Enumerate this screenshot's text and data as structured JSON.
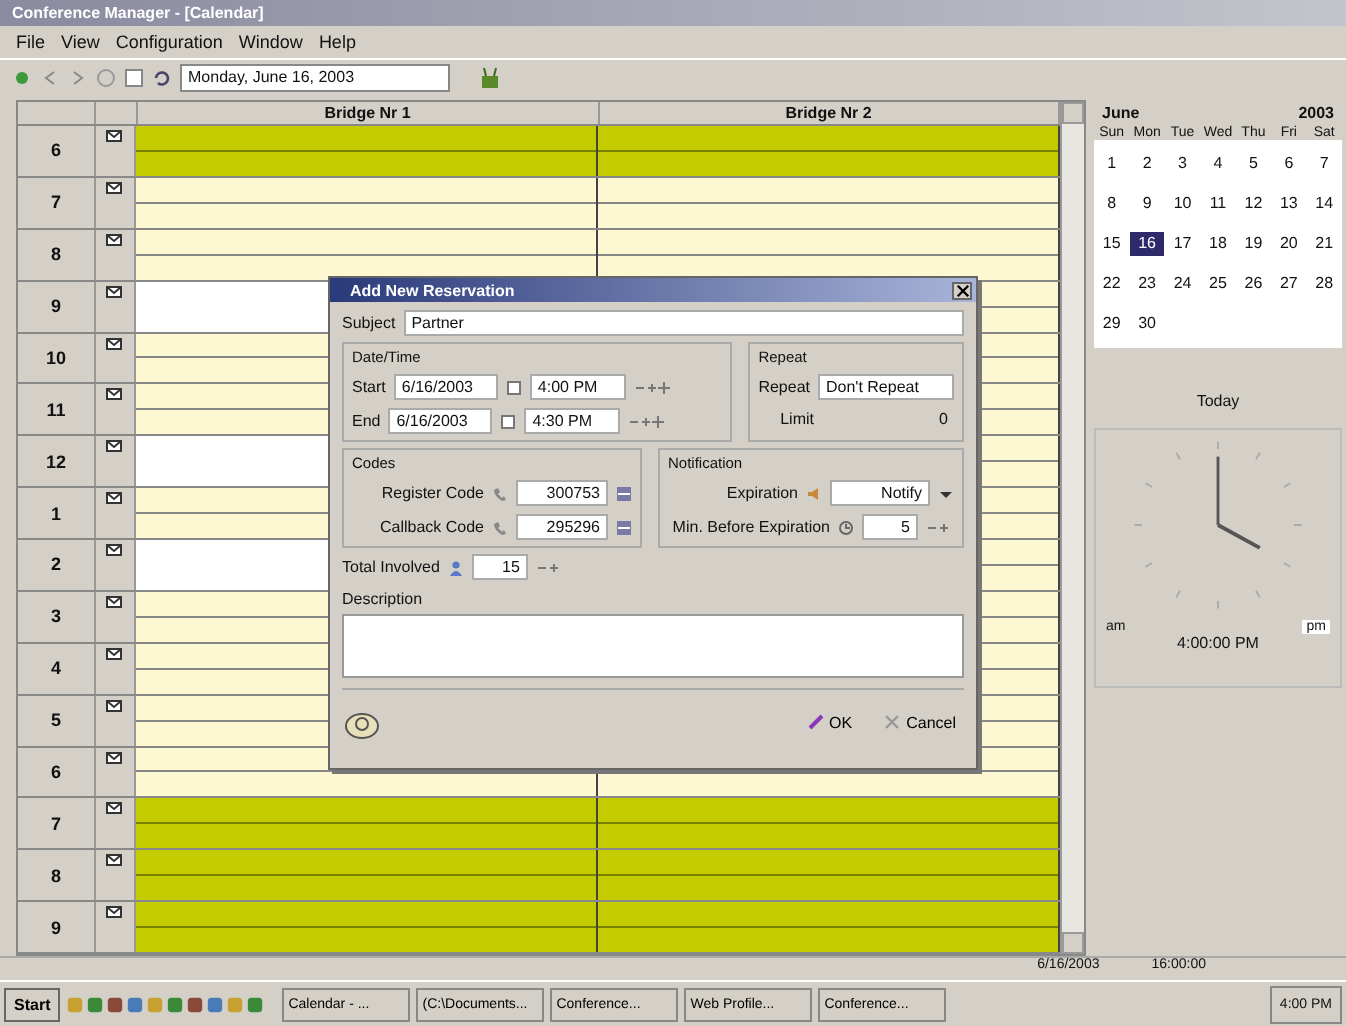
{
  "window": {
    "title": "Conference Manager - [Calendar]"
  },
  "menu": [
    "File",
    "View",
    "Configuration",
    "Window",
    "Help"
  ],
  "toolbar": {
    "date": "Monday, June 16, 2003"
  },
  "schedule": {
    "columns": [
      "Bridge Nr 1",
      "Bridge Nr 2"
    ],
    "hours": [
      {
        "label": "6",
        "kind": "closed"
      },
      {
        "label": "7",
        "kind": "open"
      },
      {
        "label": "8",
        "kind": "open"
      },
      {
        "label": "9",
        "kind": "booked"
      },
      {
        "label": "10",
        "kind": "open"
      },
      {
        "label": "11",
        "kind": "open"
      },
      {
        "label": "12",
        "kind": "booked"
      },
      {
        "label": "1",
        "kind": "open"
      },
      {
        "label": "2",
        "kind": "booked"
      },
      {
        "label": "3",
        "kind": "open"
      },
      {
        "label": "4",
        "kind": "open"
      },
      {
        "label": "5",
        "kind": "open"
      },
      {
        "label": "6",
        "kind": "open"
      },
      {
        "label": "7",
        "kind": "closed"
      },
      {
        "label": "8",
        "kind": "closed"
      },
      {
        "label": "9",
        "kind": "closed"
      }
    ]
  },
  "calendar": {
    "month": "June",
    "year": "2003",
    "weekdays": [
      "Sun",
      "Mon",
      "Tue",
      "Wed",
      "Thu",
      "Fri",
      "Sat"
    ],
    "days": [
      {
        "label": "1",
        "selected": false
      },
      {
        "label": "2",
        "selected": false
      },
      {
        "label": "3",
        "selected": false
      },
      {
        "label": "4",
        "selected": false
      },
      {
        "label": "5",
        "selected": false
      },
      {
        "label": "6",
        "selected": false
      },
      {
        "label": "7",
        "selected": false
      },
      {
        "label": "8",
        "selected": false
      },
      {
        "label": "9",
        "selected": false
      },
      {
        "label": "10",
        "selected": false
      },
      {
        "label": "11",
        "selected": false
      },
      {
        "label": "12",
        "selected": false
      },
      {
        "label": "13",
        "selected": false
      },
      {
        "label": "14",
        "selected": false
      },
      {
        "label": "15",
        "selected": false
      },
      {
        "label": "16",
        "selected": true
      },
      {
        "label": "17",
        "selected": false
      },
      {
        "label": "18",
        "selected": false
      },
      {
        "label": "19",
        "selected": false
      },
      {
        "label": "20",
        "selected": false
      },
      {
        "label": "21",
        "selected": false
      },
      {
        "label": "22",
        "selected": false
      },
      {
        "label": "23",
        "selected": false
      },
      {
        "label": "24",
        "selected": false
      },
      {
        "label": "25",
        "selected": false
      },
      {
        "label": "26",
        "selected": false
      },
      {
        "label": "27",
        "selected": false
      },
      {
        "label": "28",
        "selected": false
      },
      {
        "label": "29",
        "selected": false
      },
      {
        "label": "30",
        "selected": false
      }
    ],
    "today_button": "Today"
  },
  "clock": {
    "am": "am",
    "pm": "pm",
    "time": "4:00:00 PM"
  },
  "status_bar": [
    "6/16/2003",
    "16:00:00"
  ],
  "dialog": {
    "title": "Add New Reservation",
    "subject": {
      "label": "Subject",
      "value": "Partner"
    },
    "date_time": {
      "title": "Date/Time",
      "rows": [
        {
          "label": "Start",
          "date": "6/16/2003",
          "time": "4:00 PM"
        },
        {
          "label": "End",
          "date": "6/16/2003",
          "time": "4:30 PM"
        }
      ]
    },
    "repeat": {
      "title": "Repeat",
      "label": "Repeat",
      "value": "Don't Repeat",
      "limit_label": "Limit",
      "limit": "0"
    },
    "codes": {
      "title": "Codes",
      "items": [
        {
          "label": "Register Code",
          "value": "300753"
        },
        {
          "label": "Callback Code",
          "value": "295296"
        }
      ]
    },
    "notification": {
      "title": "Notification",
      "expiration_label": "Expiration",
      "expiration": "Notify",
      "minutes_label": "Min. Before Expiration",
      "minutes": "5"
    },
    "total": {
      "label": "Total Involved",
      "value": "15"
    },
    "description": {
      "label": "Description"
    },
    "buttons": [
      "OK",
      "Cancel"
    ]
  },
  "taskbar": {
    "start": "Start",
    "tasks": [
      "Calendar - ...",
      "(C:\\Documents...",
      "Conference...",
      "Web Profile...",
      "Conference..."
    ],
    "time": "4:00 PM"
  }
}
